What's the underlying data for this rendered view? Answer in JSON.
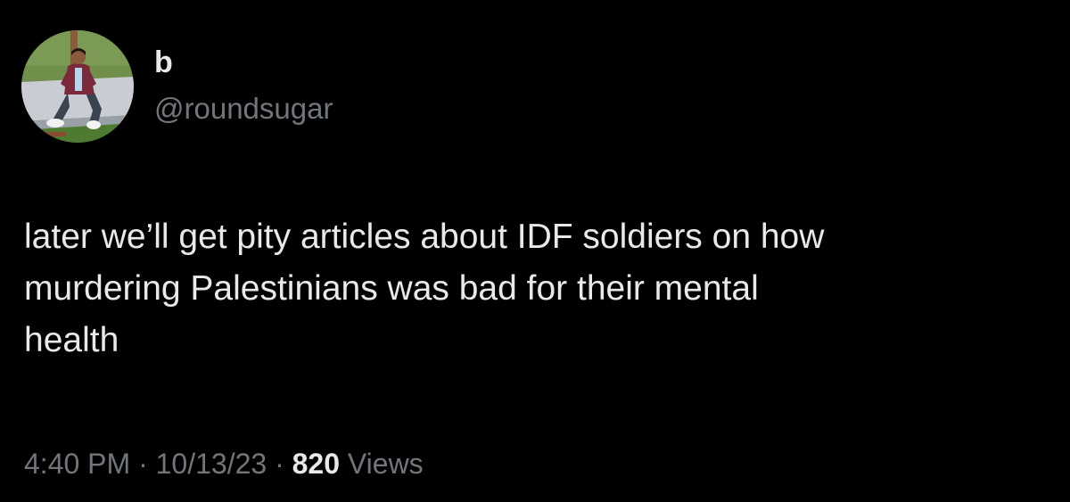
{
  "author": {
    "display_name": "b",
    "handle": "@roundsugar"
  },
  "tweet": {
    "text": "later we’ll get pity articles about IDF soldiers on how\nmurdering Palestinians was bad for their mental\nhealth",
    "time": "4:40 PM",
    "separator": "·",
    "date": "10/13/23",
    "views_count": "820",
    "views_label": "Views"
  },
  "colors": {
    "background": "#000000",
    "primary_text": "#e7e9ea",
    "secondary_text": "#71767b"
  }
}
